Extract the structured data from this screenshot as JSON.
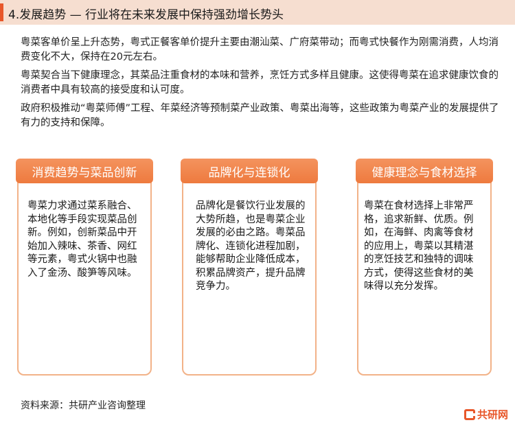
{
  "title": "4.发展趋势 — 行业将在未来发展中保持强劲增长势头",
  "paragraphs": [
    "粤菜客单价呈上升态势，粤式正餐客单价提升主要由潮汕菜、广府菜带动；而粤式快餐作为刚需消费，人均消费变化不大，保持在20元左右。",
    "粤菜契合当下健康理念，其菜品注重食材的本味和营养，烹饪方式多样且健康。这使得粤菜在追求健康饮食的消费者中具有较高的接受度和认可度。",
    "政府积极推动“粤菜师傅”工程、年菜经济等预制菜产业政策、粤菜出海等，这些政策为粤菜产业的发展提供了有力的支持和保障。"
  ],
  "cards": [
    {
      "heading": "消费趋势与菜品创新",
      "body": "粤菜力求通过菜系融合、本地化等手段实现菜品创新。例如，创新菜品中开始加入辣味、茶香、网红等元素，粤式火锅中也融入了金汤、酸笋等风味。"
    },
    {
      "heading": "品牌化与连锁化",
      "body": "品牌化是餐饮行业发展的大势所趋，也是粤菜企业发展的必由之路。粤菜品牌化、连锁化进程加剧，能够帮助企业降低成本，积累品牌资产，提升品牌竞争力。"
    },
    {
      "heading": "健康理念与食材选择",
      "body": "粤菜在食材选择上非常严格，追求新鲜、优质。例如，在海鲜、肉禽等食材的应用上，粤菜以其精湛的烹饪技艺和独特的调味方式，使得这些食材的美味得以充分发挥。"
    }
  ],
  "source": "资料来源：共研产业咨询整理",
  "logo": {
    "text": "共研网",
    "icon": "gonyn-logo-icon",
    "color": "#e8572a"
  },
  "colors": {
    "accent": "#e8572a",
    "title_bg": "#f6ded0",
    "card_border": "#f2b288",
    "card_head": "#f08448"
  }
}
